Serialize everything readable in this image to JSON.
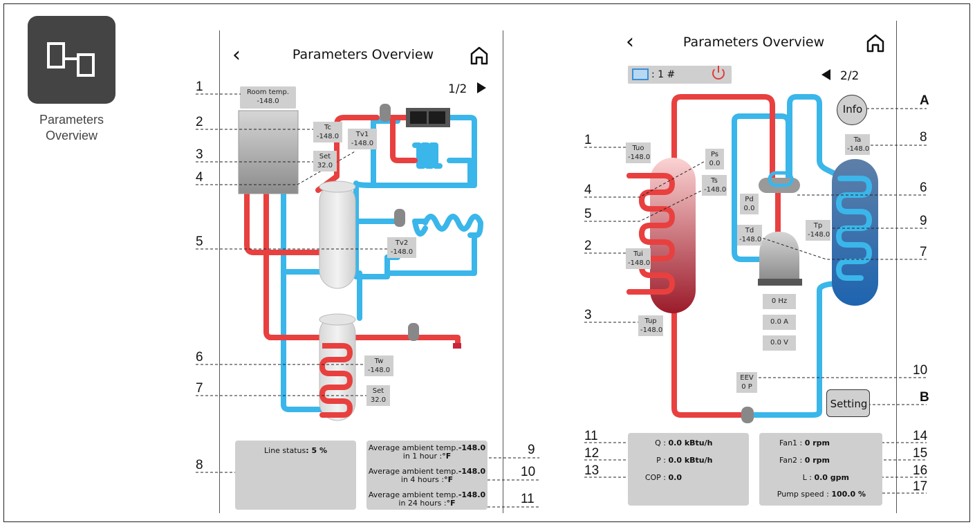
{
  "app_icon": {
    "label_line1": "Parameters",
    "label_line2": "Overview",
    "icon": "parameters-overview-icon"
  },
  "screen1": {
    "title": "Parameters Overview",
    "page": "1/2",
    "room": {
      "label": "Room temp.",
      "value": "-148.0"
    },
    "tc": {
      "label": "Tc",
      "value": "-148.0"
    },
    "set1": {
      "label": "Set",
      "value": "32.0"
    },
    "tv1": {
      "label": "Tv1",
      "value": "-148.0"
    },
    "tv2": {
      "label": "Tv2",
      "value": "-148.0"
    },
    "tw": {
      "label": "Tw",
      "value": "-148.0"
    },
    "set2": {
      "label": "Set",
      "value": "32.0"
    },
    "line_status": {
      "label": "Line status",
      "value": ": 5 %"
    },
    "avg1": {
      "line1": "Average ambient temp.",
      "value": "-148.0",
      "line2": "in 1 hour :",
      "unit": "°F"
    },
    "avg4": {
      "line1": "Average ambient temp.",
      "value": "-148.0",
      "line2": "in 4 hours :",
      "unit": "°F"
    },
    "avg24": {
      "line1": "Average ambient temp.",
      "value": "-148.0",
      "line2": "in 24 hours :",
      "unit": "°F"
    },
    "callouts": [
      "1",
      "2",
      "3",
      "4",
      "5",
      "6",
      "7",
      "8",
      "9",
      "10",
      "11"
    ]
  },
  "screen2": {
    "title": "Parameters Overview",
    "unit_label": ": 1 #",
    "page": "2/2",
    "info_button": "Info",
    "setting_button": "Setting",
    "tuo": {
      "label": "Tuo",
      "value": "-148.0"
    },
    "tui": {
      "label": "Tui",
      "value": "-148.0"
    },
    "tup": {
      "label": "Tup",
      "value": "-148.0"
    },
    "ps": {
      "label": "Ps",
      "value": "0.0"
    },
    "ts": {
      "label": "Ts",
      "value": "-148.0"
    },
    "pd": {
      "label": "Pd",
      "value": "0.0"
    },
    "td": {
      "label": "Td",
      "value": "-148.0"
    },
    "ta": {
      "label": "Ta",
      "value": "-148.0"
    },
    "tp": {
      "label": "Tp",
      "value": "-148.0"
    },
    "hz": "0 Hz",
    "amp": "0.0 A",
    "volt": "0.0 V",
    "eev": {
      "label": "EEV",
      "value": "0 P"
    },
    "q": {
      "label": "Q :",
      "value": "0.0 kBtu/h"
    },
    "p": {
      "label": "P :",
      "value": "0.0 kBtu/h"
    },
    "cop": {
      "label": "COP :",
      "value": "0.0"
    },
    "fan1": {
      "label": "Fan1 :",
      "value": "0 rpm"
    },
    "fan2": {
      "label": "Fan2 :",
      "value": "0 rpm"
    },
    "l": {
      "label": "L :",
      "value": "0.0 gpm"
    },
    "pump": {
      "label": "Pump speed :",
      "value": "100.0 %"
    },
    "callouts_left": [
      "1",
      "4",
      "5",
      "2",
      "3",
      "11",
      "12",
      "13"
    ],
    "callouts_right": [
      "A",
      "8",
      "6",
      "9",
      "7",
      "10",
      "B",
      "14",
      "15",
      "16",
      "17"
    ]
  },
  "colors": {
    "hot": "#e8403f",
    "cold": "#3ab6ea",
    "panel": "#cfcfcf",
    "gray": "#7a7a7a"
  }
}
